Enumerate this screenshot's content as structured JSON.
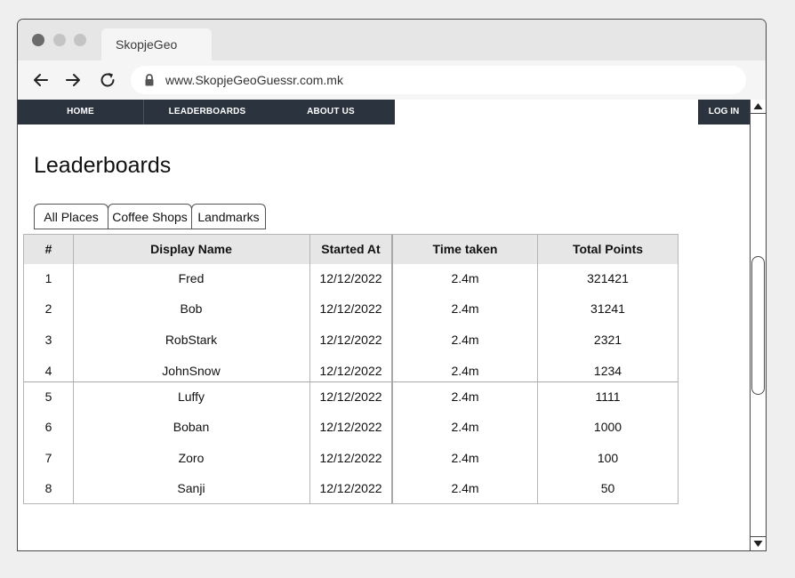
{
  "browser": {
    "tab_title": "SkopjeGeo",
    "url": "www.SkopjeGeoGuessr.com.mk"
  },
  "nav": {
    "items": [
      {
        "label": "HOME"
      },
      {
        "label": "LEADERBOARDS"
      },
      {
        "label": "ABOUT US"
      }
    ],
    "login_label": "LOG IN"
  },
  "page": {
    "title": "Leaderboards"
  },
  "filter_tabs": [
    {
      "label": "All Places"
    },
    {
      "label": "Coffee Shops"
    },
    {
      "label": "Landmarks"
    }
  ],
  "table": {
    "columns": [
      "#",
      "Display Name",
      "Started At",
      "Time taken",
      "Total Points"
    ],
    "rows": [
      [
        "1",
        "Fred",
        "12/12/2022",
        "2.4m",
        "321421"
      ],
      [
        "2",
        "Bob",
        "12/12/2022",
        "2.4m",
        "31241"
      ],
      [
        "3",
        "RobStark",
        "12/12/2022",
        "2.4m",
        "2321"
      ],
      [
        "4",
        "JohnSnow",
        "12/12/2022",
        "2.4m",
        "1234"
      ],
      [
        "5",
        "Luffy",
        "12/12/2022",
        "2.4m",
        "1111"
      ],
      [
        "6",
        "Boban",
        "12/12/2022",
        "2.4m",
        "1000"
      ],
      [
        "7",
        "Zoro",
        "12/12/2022",
        "2.4m",
        "100"
      ],
      [
        "8",
        "Sanji",
        "12/12/2022",
        "2.4m",
        "50"
      ]
    ]
  },
  "icons": {
    "back": "arrow-left-icon",
    "forward": "arrow-right-icon",
    "reload": "reload-icon",
    "lock": "lock-icon",
    "scroll_up": "scroll-up-arrow-icon",
    "scroll_down": "scroll-down-arrow-icon"
  },
  "colors": {
    "navbar": "#2b333e",
    "header_bg": "#e6e6e6"
  }
}
